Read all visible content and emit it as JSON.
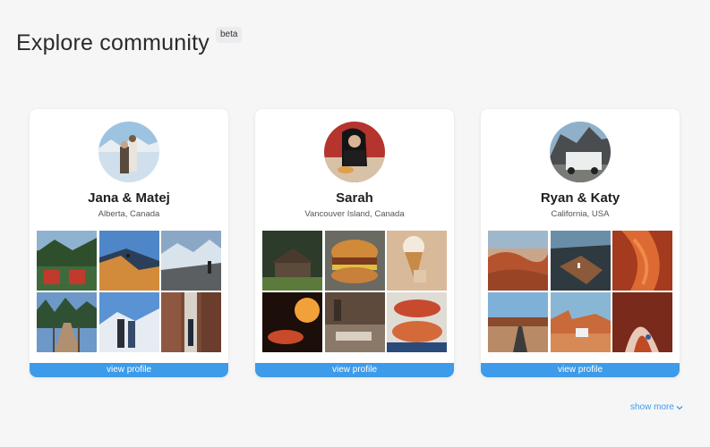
{
  "header": {
    "title": "Explore community",
    "badge": "beta"
  },
  "profiles": [
    {
      "name": "Jana & Matej",
      "location": "Alberta, Canada",
      "button": "view profile"
    },
    {
      "name": "Sarah",
      "location": "Vancouver Island, Canada",
      "button": "view profile"
    },
    {
      "name": "Ryan & Katy",
      "location": "California, USA",
      "button": "view profile"
    }
  ],
  "footer": {
    "show_more": "show more",
    "show_more_icon": "chevron-down-icon"
  },
  "colors": {
    "accent": "#3d9be9",
    "background": "#f6f6f7",
    "card": "#ffffff"
  }
}
